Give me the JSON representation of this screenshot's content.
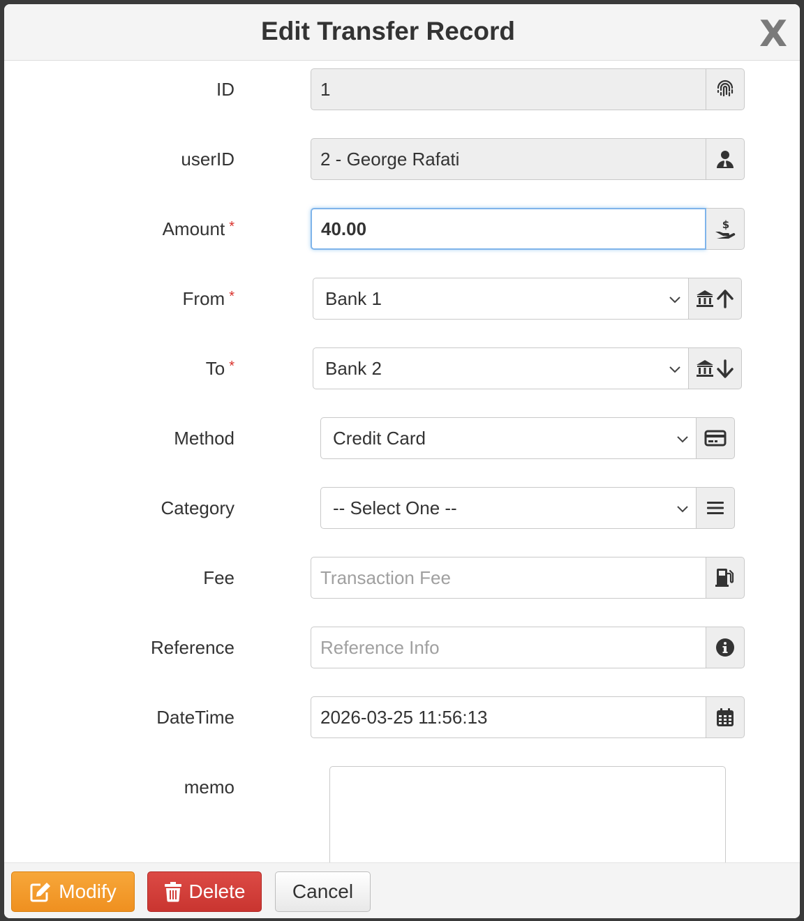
{
  "dialog": {
    "title": "Edit Transfer Record",
    "close_label": "X"
  },
  "fields": {
    "id": {
      "label": "ID",
      "value": "1",
      "icon": "fingerprint-icon"
    },
    "userid": {
      "label": "userID",
      "value": "2 - George Rafati",
      "icon": "user-tie-icon"
    },
    "amount": {
      "label": "Amount",
      "required": "*",
      "value": "40.00",
      "icon": "hand-holding-dollar-icon"
    },
    "from": {
      "label": "From",
      "required": "*",
      "selected": "Bank 1",
      "icon": "bank-arrow-up-icon"
    },
    "to": {
      "label": "To",
      "required": "*",
      "selected": "Bank 2",
      "icon": "bank-arrow-down-icon"
    },
    "method": {
      "label": "Method",
      "selected": "Credit Card",
      "icon": "credit-card-icon"
    },
    "category": {
      "label": "Category",
      "selected": "-- Select One --",
      "icon": "list-icon"
    },
    "fee": {
      "label": "Fee",
      "placeholder": "Transaction Fee",
      "icon": "gas-pump-icon"
    },
    "reference": {
      "label": "Reference",
      "placeholder": "Reference Info",
      "icon": "info-circle-icon"
    },
    "datetime": {
      "label": "DateTime",
      "value": "2026-03-25 11:56:13",
      "icon": "calendar-icon"
    },
    "memo": {
      "label": "memo",
      "value": ""
    }
  },
  "footer": {
    "modify_label": "Modify",
    "delete_label": "Delete",
    "cancel_label": "Cancel"
  },
  "colors": {
    "modify": "#f19a2a",
    "delete": "#d13f3a",
    "required": "#d9312b",
    "focus_border": "#7fb4ea"
  }
}
